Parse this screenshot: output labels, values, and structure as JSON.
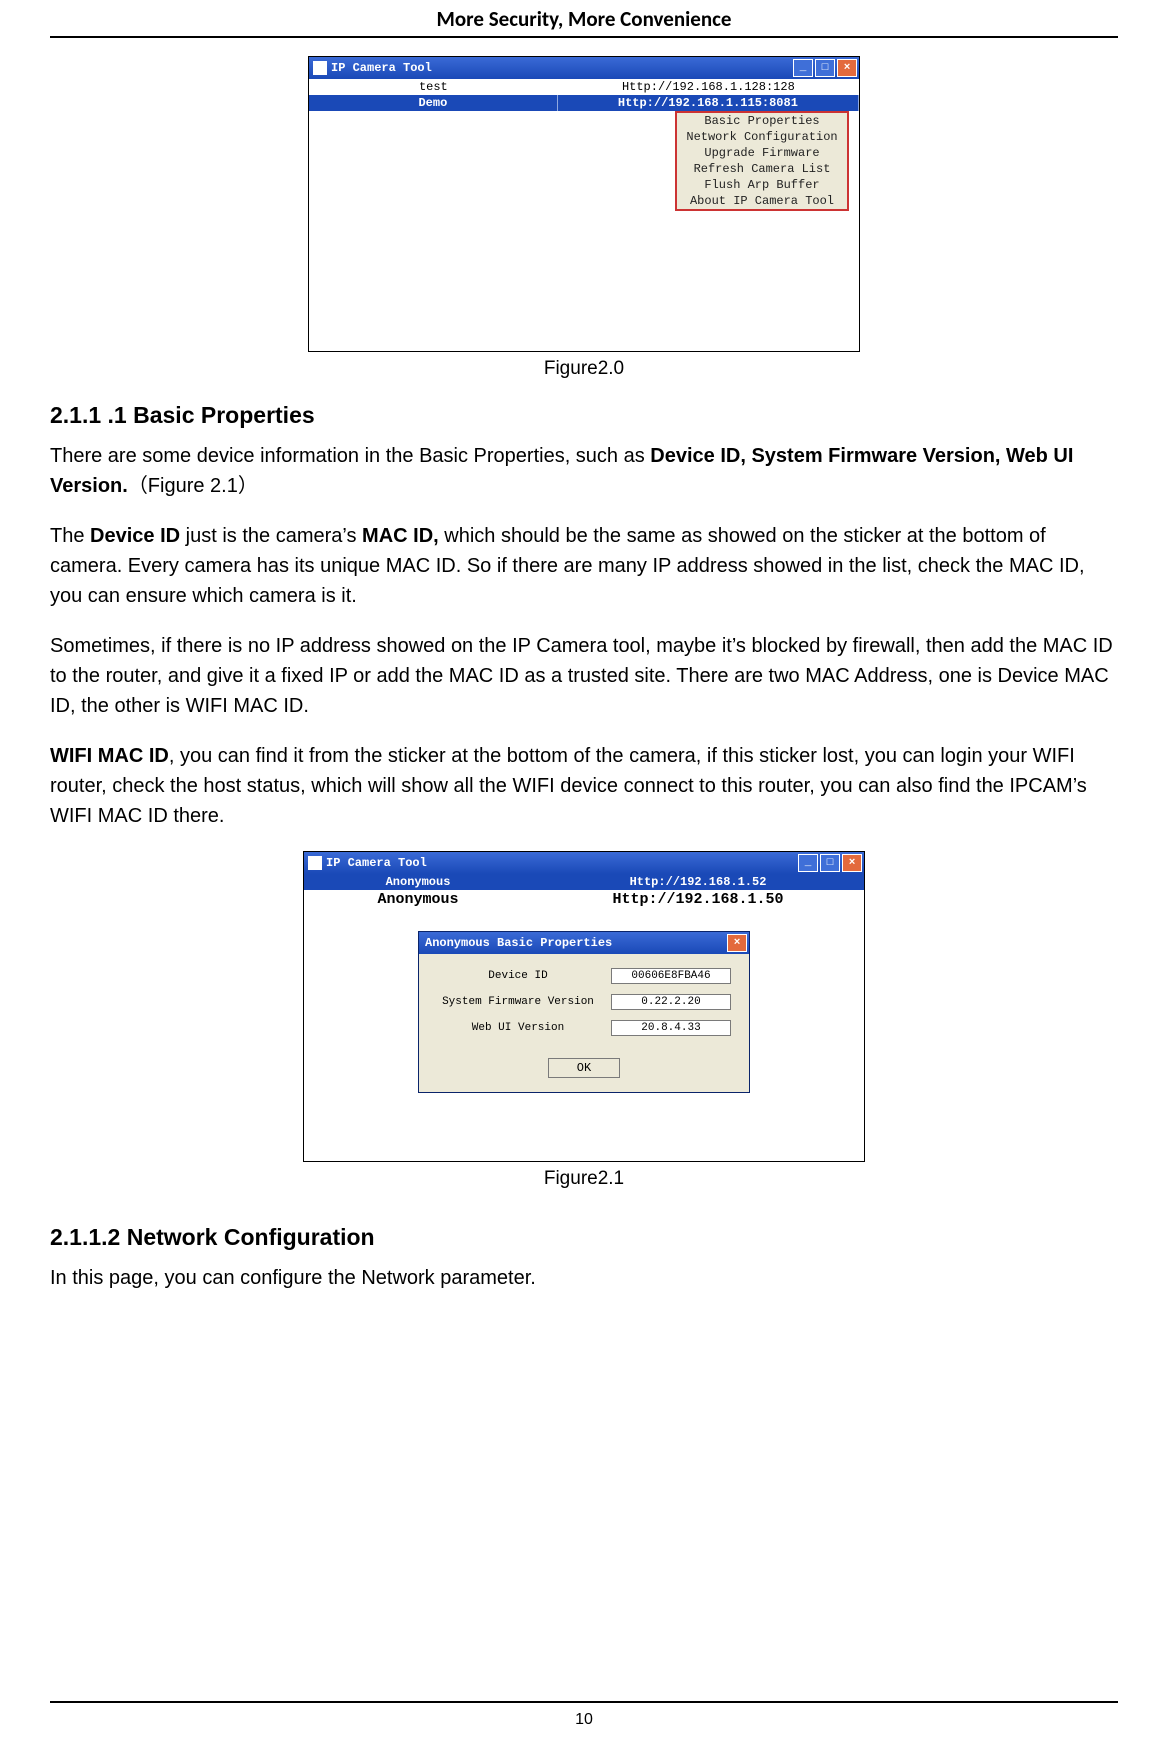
{
  "page": {
    "header": "More Security, More Convenience",
    "number": "10"
  },
  "fig20": {
    "caption": "Figure2.0",
    "window_title": "IP Camera Tool",
    "rows": [
      {
        "name": "test",
        "url": "Http://192.168.1.128:128"
      },
      {
        "name": "Demo",
        "url": "Http://192.168.1.115:8081"
      }
    ],
    "menu": [
      "Basic Properties",
      "Network Configuration",
      "Upgrade Firmware",
      "Refresh Camera List",
      "Flush Arp Buffer",
      "About IP Camera Tool"
    ]
  },
  "section211": {
    "heading": "2.1.1 .1 Basic Properties",
    "p1a": "There are some device information in the Basic Properties, such as ",
    "p1b": "Device ID, System Firmware Version, Web UI Version.",
    "p1c": "（Figure 2.1）",
    "p2a": "The ",
    "p2b": "Device ID",
    "p2c": " just is the camera’s ",
    "p2d": "MAC ID,",
    "p2e": " which should be the same as showed on the sticker at the bottom of camera. Every camera has its unique MAC ID. So if there are many IP address showed in the list, check the MAC ID, you can ensure which camera is it.",
    "p3": "Sometimes, if there is no IP address showed on the IP Camera tool, maybe it’s blocked by firewall, then add the MAC ID to the router, and give it a fixed IP or add the MAC ID as a trusted site. There are two MAC Address, one is Device MAC ID, the other is WIFI MAC ID.",
    "p4a": "WIFI MAC ID",
    "p4b": ", you can find it from the sticker at the bottom of the camera, if this sticker lost, you can login your WIFI router, check the host status, which will show all the WIFI device connect to this router, you can also find the IPCAM’s WIFI MAC ID there."
  },
  "fig21": {
    "caption": "Figure2.1",
    "window_title": "IP Camera Tool",
    "rows": [
      {
        "name": "Anonymous",
        "url": "Http://192.168.1.52"
      },
      {
        "name": "Anonymous",
        "url": "Http://192.168.1.50"
      }
    ],
    "dlg": {
      "title": "Anonymous Basic Properties",
      "fields": [
        {
          "label": "Device ID",
          "value": "00606E8FBA46"
        },
        {
          "label": "System Firmware Version",
          "value": "0.22.2.20"
        },
        {
          "label": "Web UI Version",
          "value": "20.8.4.33"
        }
      ],
      "ok": "OK"
    }
  },
  "section2112": {
    "heading": "2.1.1.2 Network Configuration",
    "p1": "In this page, you can configure the Network parameter."
  }
}
